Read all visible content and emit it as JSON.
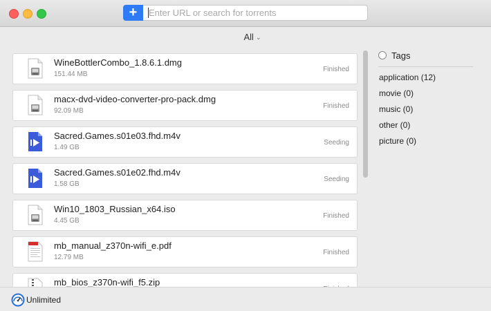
{
  "toolbar": {
    "add_label": "+",
    "search_placeholder": "Enter URL or search for torrents"
  },
  "filter": {
    "label": "All"
  },
  "torrents": [
    {
      "name": "WineBottlerCombo_1.8.6.1.dmg",
      "size": "151.44 MB",
      "status": "Finished",
      "icon": "disk-image-icon"
    },
    {
      "name": "macx-dvd-video-converter-pro-pack.dmg",
      "size": "92.09 MB",
      "status": "Finished",
      "icon": "disk-image-icon"
    },
    {
      "name": "Sacred.Games.s01e03.fhd.m4v",
      "size": "1.49 GB",
      "status": "Seeding",
      "icon": "video-file-icon"
    },
    {
      "name": "Sacred.Games.s01e02.fhd.m4v",
      "size": "1.58 GB",
      "status": "Seeding",
      "icon": "video-file-icon"
    },
    {
      "name": "Win10_1803_Russian_x64.iso",
      "size": "4.45 GB",
      "status": "Finished",
      "icon": "disk-image-icon"
    },
    {
      "name": "mb_manual_z370n-wifi_e.pdf",
      "size": "12.79 MB",
      "status": "Finished",
      "icon": "pdf-file-icon"
    },
    {
      "name": "mb_bios_z370n-wifi_f5.zip",
      "size": "",
      "status": "Finished",
      "icon": "zip-file-icon"
    }
  ],
  "tags": {
    "header": "Tags",
    "items": [
      "application (12)",
      "movie (0)",
      "music (0)",
      "other (0)",
      "picture (0)"
    ]
  },
  "footer": {
    "speed_label": "Unlimited"
  },
  "colors": {
    "accent": "#2f7bf5",
    "video_icon": "#3b5bdb",
    "pdf_icon": "#d32f2f"
  }
}
